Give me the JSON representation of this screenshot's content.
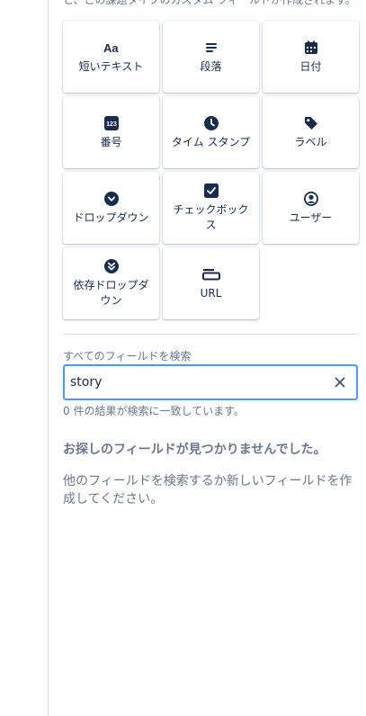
{
  "intro": {
    "text": "と、この課題タイプのカスタム フィールドが作成されます。"
  },
  "field_types": [
    {
      "label": "短いテキスト",
      "icon": "short-text-icon"
    },
    {
      "label": "段落",
      "icon": "paragraph-icon"
    },
    {
      "label": "日付",
      "icon": "calendar-icon"
    },
    {
      "label": "番号",
      "icon": "number-icon"
    },
    {
      "label": "タイム スタンプ",
      "icon": "clock-icon"
    },
    {
      "label": "ラベル",
      "icon": "tag-icon"
    },
    {
      "label": "ドロップダウン",
      "icon": "dropdown-icon"
    },
    {
      "label": "チェックボックス",
      "icon": "checkbox-icon"
    },
    {
      "label": "ユーザー",
      "icon": "user-icon"
    },
    {
      "label": "依存ドロップダウン",
      "icon": "dependent-dropdown-icon"
    },
    {
      "label": "URL",
      "icon": "url-icon"
    }
  ],
  "search": {
    "label": "すべてのフィールドを検索",
    "value": "story",
    "result_count": "0 件の結果が検索に一致しています。"
  },
  "empty_state": {
    "title": "お探しのフィールドが見つかりませんでした。",
    "description": "他のフィールドを検索するか新しいフィールドを作成してください。"
  },
  "colors": {
    "focus_border": "#4c9aff",
    "icon": "#172b4d",
    "muted_text": "#6b778c"
  }
}
